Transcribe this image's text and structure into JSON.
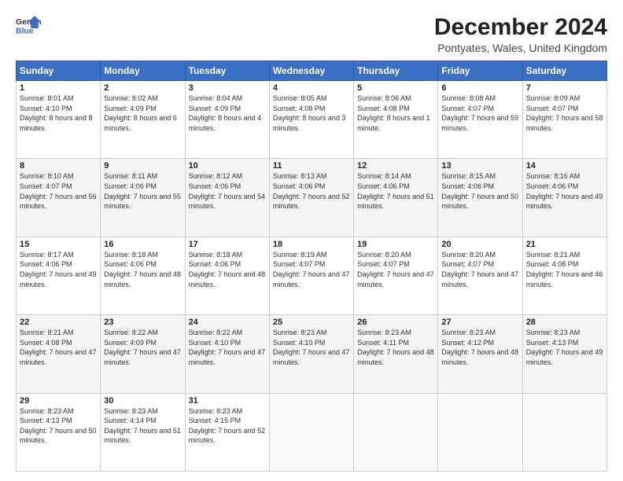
{
  "header": {
    "logo_line1": "General",
    "logo_line2": "Blue",
    "title": "December 2024",
    "subtitle": "Pontyates, Wales, United Kingdom"
  },
  "days_of_week": [
    "Sunday",
    "Monday",
    "Tuesday",
    "Wednesday",
    "Thursday",
    "Friday",
    "Saturday"
  ],
  "weeks": [
    [
      {
        "day": "1",
        "sunrise": "Sunrise: 8:01 AM",
        "sunset": "Sunset: 4:10 PM",
        "daylight": "Daylight: 8 hours and 8 minutes."
      },
      {
        "day": "2",
        "sunrise": "Sunrise: 8:02 AM",
        "sunset": "Sunset: 4:09 PM",
        "daylight": "Daylight: 8 hours and 6 minutes."
      },
      {
        "day": "3",
        "sunrise": "Sunrise: 8:04 AM",
        "sunset": "Sunset: 4:09 PM",
        "daylight": "Daylight: 8 hours and 4 minutes."
      },
      {
        "day": "4",
        "sunrise": "Sunrise: 8:05 AM",
        "sunset": "Sunset: 4:08 PM",
        "daylight": "Daylight: 8 hours and 3 minutes."
      },
      {
        "day": "5",
        "sunrise": "Sunrise: 8:06 AM",
        "sunset": "Sunset: 4:08 PM",
        "daylight": "Daylight: 8 hours and 1 minute."
      },
      {
        "day": "6",
        "sunrise": "Sunrise: 8:08 AM",
        "sunset": "Sunset: 4:07 PM",
        "daylight": "Daylight: 7 hours and 59 minutes."
      },
      {
        "day": "7",
        "sunrise": "Sunrise: 8:09 AM",
        "sunset": "Sunset: 4:07 PM",
        "daylight": "Daylight: 7 hours and 58 minutes."
      }
    ],
    [
      {
        "day": "8",
        "sunrise": "Sunrise: 8:10 AM",
        "sunset": "Sunset: 4:07 PM",
        "daylight": "Daylight: 7 hours and 56 minutes."
      },
      {
        "day": "9",
        "sunrise": "Sunrise: 8:11 AM",
        "sunset": "Sunset: 4:06 PM",
        "daylight": "Daylight: 7 hours and 55 minutes."
      },
      {
        "day": "10",
        "sunrise": "Sunrise: 8:12 AM",
        "sunset": "Sunset: 4:06 PM",
        "daylight": "Daylight: 7 hours and 54 minutes."
      },
      {
        "day": "11",
        "sunrise": "Sunrise: 8:13 AM",
        "sunset": "Sunset: 4:06 PM",
        "daylight": "Daylight: 7 hours and 52 minutes."
      },
      {
        "day": "12",
        "sunrise": "Sunrise: 8:14 AM",
        "sunset": "Sunset: 4:06 PM",
        "daylight": "Daylight: 7 hours and 51 minutes."
      },
      {
        "day": "13",
        "sunrise": "Sunrise: 8:15 AM",
        "sunset": "Sunset: 4:06 PM",
        "daylight": "Daylight: 7 hours and 50 minutes."
      },
      {
        "day": "14",
        "sunrise": "Sunrise: 8:16 AM",
        "sunset": "Sunset: 4:06 PM",
        "daylight": "Daylight: 7 hours and 49 minutes."
      }
    ],
    [
      {
        "day": "15",
        "sunrise": "Sunrise: 8:17 AM",
        "sunset": "Sunset: 4:06 PM",
        "daylight": "Daylight: 7 hours and 49 minutes."
      },
      {
        "day": "16",
        "sunrise": "Sunrise: 8:18 AM",
        "sunset": "Sunset: 4:06 PM",
        "daylight": "Daylight: 7 hours and 48 minutes."
      },
      {
        "day": "17",
        "sunrise": "Sunrise: 8:18 AM",
        "sunset": "Sunset: 4:06 PM",
        "daylight": "Daylight: 7 hours and 48 minutes."
      },
      {
        "day": "18",
        "sunrise": "Sunrise: 8:19 AM",
        "sunset": "Sunset: 4:07 PM",
        "daylight": "Daylight: 7 hours and 47 minutes."
      },
      {
        "day": "19",
        "sunrise": "Sunrise: 8:20 AM",
        "sunset": "Sunset: 4:07 PM",
        "daylight": "Daylight: 7 hours and 47 minutes."
      },
      {
        "day": "20",
        "sunrise": "Sunrise: 8:20 AM",
        "sunset": "Sunset: 4:07 PM",
        "daylight": "Daylight: 7 hours and 47 minutes."
      },
      {
        "day": "21",
        "sunrise": "Sunrise: 8:21 AM",
        "sunset": "Sunset: 4:08 PM",
        "daylight": "Daylight: 7 hours and 46 minutes."
      }
    ],
    [
      {
        "day": "22",
        "sunrise": "Sunrise: 8:21 AM",
        "sunset": "Sunset: 4:08 PM",
        "daylight": "Daylight: 7 hours and 47 minutes."
      },
      {
        "day": "23",
        "sunrise": "Sunrise: 8:22 AM",
        "sunset": "Sunset: 4:09 PM",
        "daylight": "Daylight: 7 hours and 47 minutes."
      },
      {
        "day": "24",
        "sunrise": "Sunrise: 8:22 AM",
        "sunset": "Sunset: 4:10 PM",
        "daylight": "Daylight: 7 hours and 47 minutes."
      },
      {
        "day": "25",
        "sunrise": "Sunrise: 8:23 AM",
        "sunset": "Sunset: 4:10 PM",
        "daylight": "Daylight: 7 hours and 47 minutes."
      },
      {
        "day": "26",
        "sunrise": "Sunrise: 8:23 AM",
        "sunset": "Sunset: 4:11 PM",
        "daylight": "Daylight: 7 hours and 48 minutes."
      },
      {
        "day": "27",
        "sunrise": "Sunrise: 8:23 AM",
        "sunset": "Sunset: 4:12 PM",
        "daylight": "Daylight: 7 hours and 48 minutes."
      },
      {
        "day": "28",
        "sunrise": "Sunrise: 8:23 AM",
        "sunset": "Sunset: 4:13 PM",
        "daylight": "Daylight: 7 hours and 49 minutes."
      }
    ],
    [
      {
        "day": "29",
        "sunrise": "Sunrise: 8:23 AM",
        "sunset": "Sunset: 4:13 PM",
        "daylight": "Daylight: 7 hours and 50 minutes."
      },
      {
        "day": "30",
        "sunrise": "Sunrise: 8:23 AM",
        "sunset": "Sunset: 4:14 PM",
        "daylight": "Daylight: 7 hours and 51 minutes."
      },
      {
        "day": "31",
        "sunrise": "Sunrise: 8:23 AM",
        "sunset": "Sunset: 4:15 PM",
        "daylight": "Daylight: 7 hours and 52 minutes."
      },
      null,
      null,
      null,
      null
    ]
  ]
}
